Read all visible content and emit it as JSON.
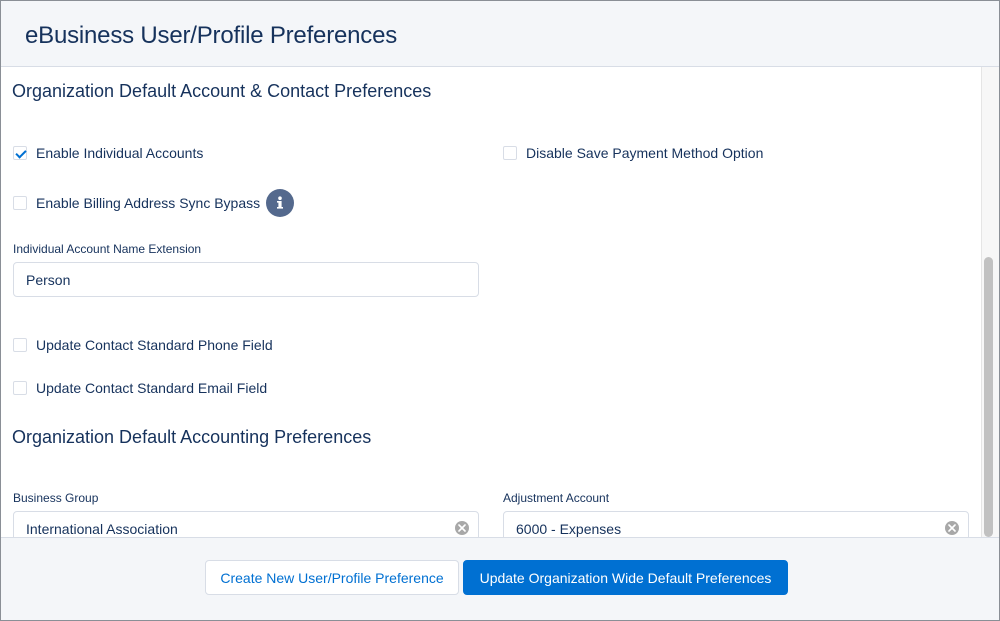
{
  "header": {
    "title": "eBusiness User/Profile Preferences"
  },
  "account_section": {
    "title": "Organization Default Account & Contact Preferences",
    "enable_individual_accounts": {
      "label": "Enable Individual Accounts",
      "checked": true
    },
    "disable_save_payment": {
      "label": "Disable Save Payment Method Option",
      "checked": false
    },
    "enable_billing_sync_bypass": {
      "label": "Enable Billing Address Sync Bypass",
      "checked": false,
      "icon": "info-icon"
    },
    "name_extension": {
      "label": "Individual Account Name Extension",
      "value": "Person"
    },
    "update_phone": {
      "label": "Update Contact Standard Phone Field",
      "checked": false
    },
    "update_email": {
      "label": "Update Contact Standard Email Field",
      "checked": false
    }
  },
  "accounting_section": {
    "title": "Organization Default Accounting Preferences",
    "business_group": {
      "label": "Business Group",
      "value": "International Association",
      "icon": "clear-icon"
    },
    "adjustment_account": {
      "label": "Adjustment Account",
      "value": "6000 - Expenses",
      "icon": "clear-icon"
    }
  },
  "footer": {
    "create_button": "Create New User/Profile Preference",
    "update_button": "Update Organization Wide Default Preferences"
  },
  "colors": {
    "brand": "#0070d2",
    "text": "#16325c",
    "info_icon": "#54698d",
    "header_bg": "#f4f6f9"
  }
}
